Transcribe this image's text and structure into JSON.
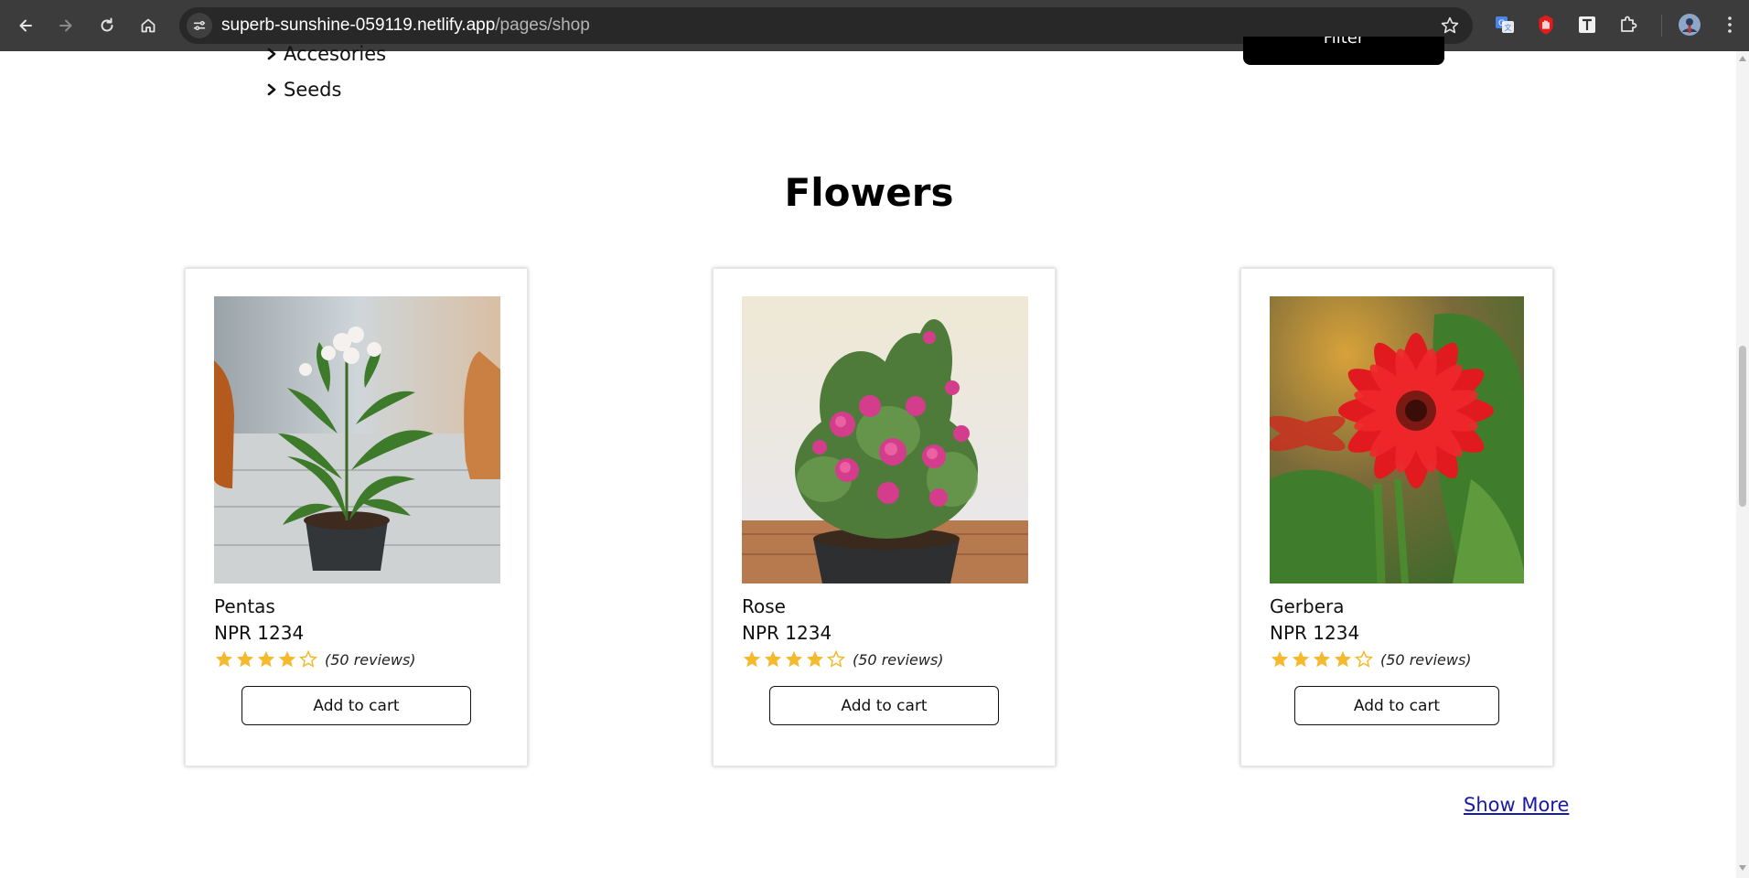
{
  "browser": {
    "url_host": "superb-sunshine-059119.netlify.app",
    "url_path": "/pages/shop",
    "back_icon": "arrow-left-icon",
    "forward_icon": "arrow-right-icon",
    "reload_icon": "reload-icon",
    "home_icon": "home-icon",
    "site_info_icon": "tune-icon",
    "bookmark_icon": "star-outline-icon",
    "extensions": [
      "translate-icon",
      "stop-hand-icon",
      "text-t-icon",
      "puzzle-icon",
      "profile-avatar-icon",
      "kebab-menu-icon"
    ]
  },
  "categories": {
    "items": [
      {
        "label": "Accesories",
        "icon": "chevron-right-icon"
      },
      {
        "label": "Seeds",
        "icon": "chevron-right-icon"
      }
    ]
  },
  "filter": {
    "label": "Filter"
  },
  "section": {
    "title": "Flowers"
  },
  "products": [
    {
      "name": "Pentas",
      "price": "NPR 1234",
      "rating": 4,
      "rating_max": 5,
      "reviews": "(50 reviews)",
      "cart_label": "Add to cart",
      "image": "pentas-potted-plant-photo"
    },
    {
      "name": "Rose",
      "price": "NPR 1234",
      "rating": 4,
      "rating_max": 5,
      "reviews": "(50 reviews)",
      "cart_label": "Add to cart",
      "image": "rose-potted-plant-photo"
    },
    {
      "name": "Gerbera",
      "price": "NPR 1234",
      "rating": 4,
      "rating_max": 5,
      "reviews": "(50 reviews)",
      "cart_label": "Add to cart",
      "image": "gerbera-red-flower-photo"
    }
  ],
  "show_more": {
    "label": "Show More"
  },
  "colors": {
    "star_fill": "#f5b92e",
    "link": "#1a1aa6",
    "chrome_bg": "#3c3c3c"
  }
}
